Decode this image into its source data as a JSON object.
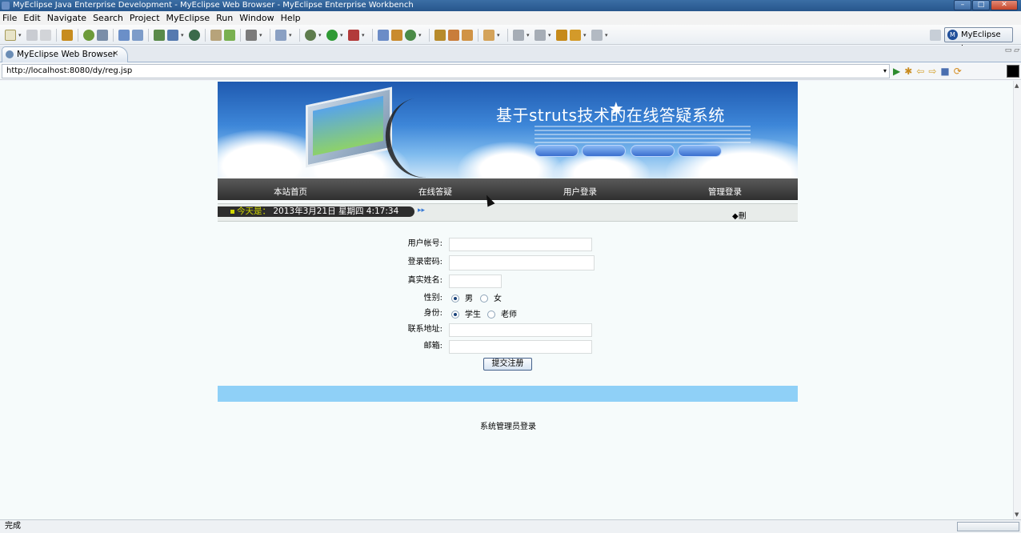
{
  "window": {
    "title": "MyEclipse Java Enterprise Development - MyEclipse Web Browser - MyEclipse Enterprise Workbench",
    "buttons": [
      "–",
      "□",
      "✕"
    ]
  },
  "menu": [
    "File",
    "Edit",
    "Navigate",
    "Search",
    "Project",
    "MyEclipse",
    "Run",
    "Window",
    "Help"
  ],
  "perspective": {
    "label": "MyEclipse J...",
    "icon_letter": "M"
  },
  "editor_tab": {
    "label": "MyEclipse Web Browser",
    "close": "✕"
  },
  "view_controls": "▭ ▱",
  "address_bar": {
    "url": "http://localhost:8080/dy/reg.jsp",
    "dropdown": "▾"
  },
  "nav_icons": [
    "▶",
    "✱",
    "⇦",
    "⇨",
    "■",
    "⟳"
  ],
  "site": {
    "banner_title": "基于struts技术的在线答疑系统",
    "nav": [
      "本站首页",
      "在线答疑",
      "用户登录",
      "管理登录"
    ],
    "date_prefix": "今天是：",
    "date_text": "2013年3月21日 星期四 4:17:34",
    "date_arrow": "▸▸",
    "date_side_text": "◆刪"
  },
  "form": {
    "username_label": "用户帐号:",
    "password_label": "登录密码:",
    "realname_label": "真实姓名:",
    "gender_label": "性别:",
    "gender_male": "男",
    "gender_female": "女",
    "role_label": "身份:",
    "role_student": "学生",
    "role_teacher": "老师",
    "address_label": "联系地址:",
    "email_label": "邮箱:",
    "submit_label": "提交注册",
    "gender_selected": "男",
    "role_selected": "学生"
  },
  "admin_link": "系统管理员登录",
  "status": {
    "text": "完成"
  },
  "scrollbar": {
    "up": "▲",
    "down": "▼"
  }
}
